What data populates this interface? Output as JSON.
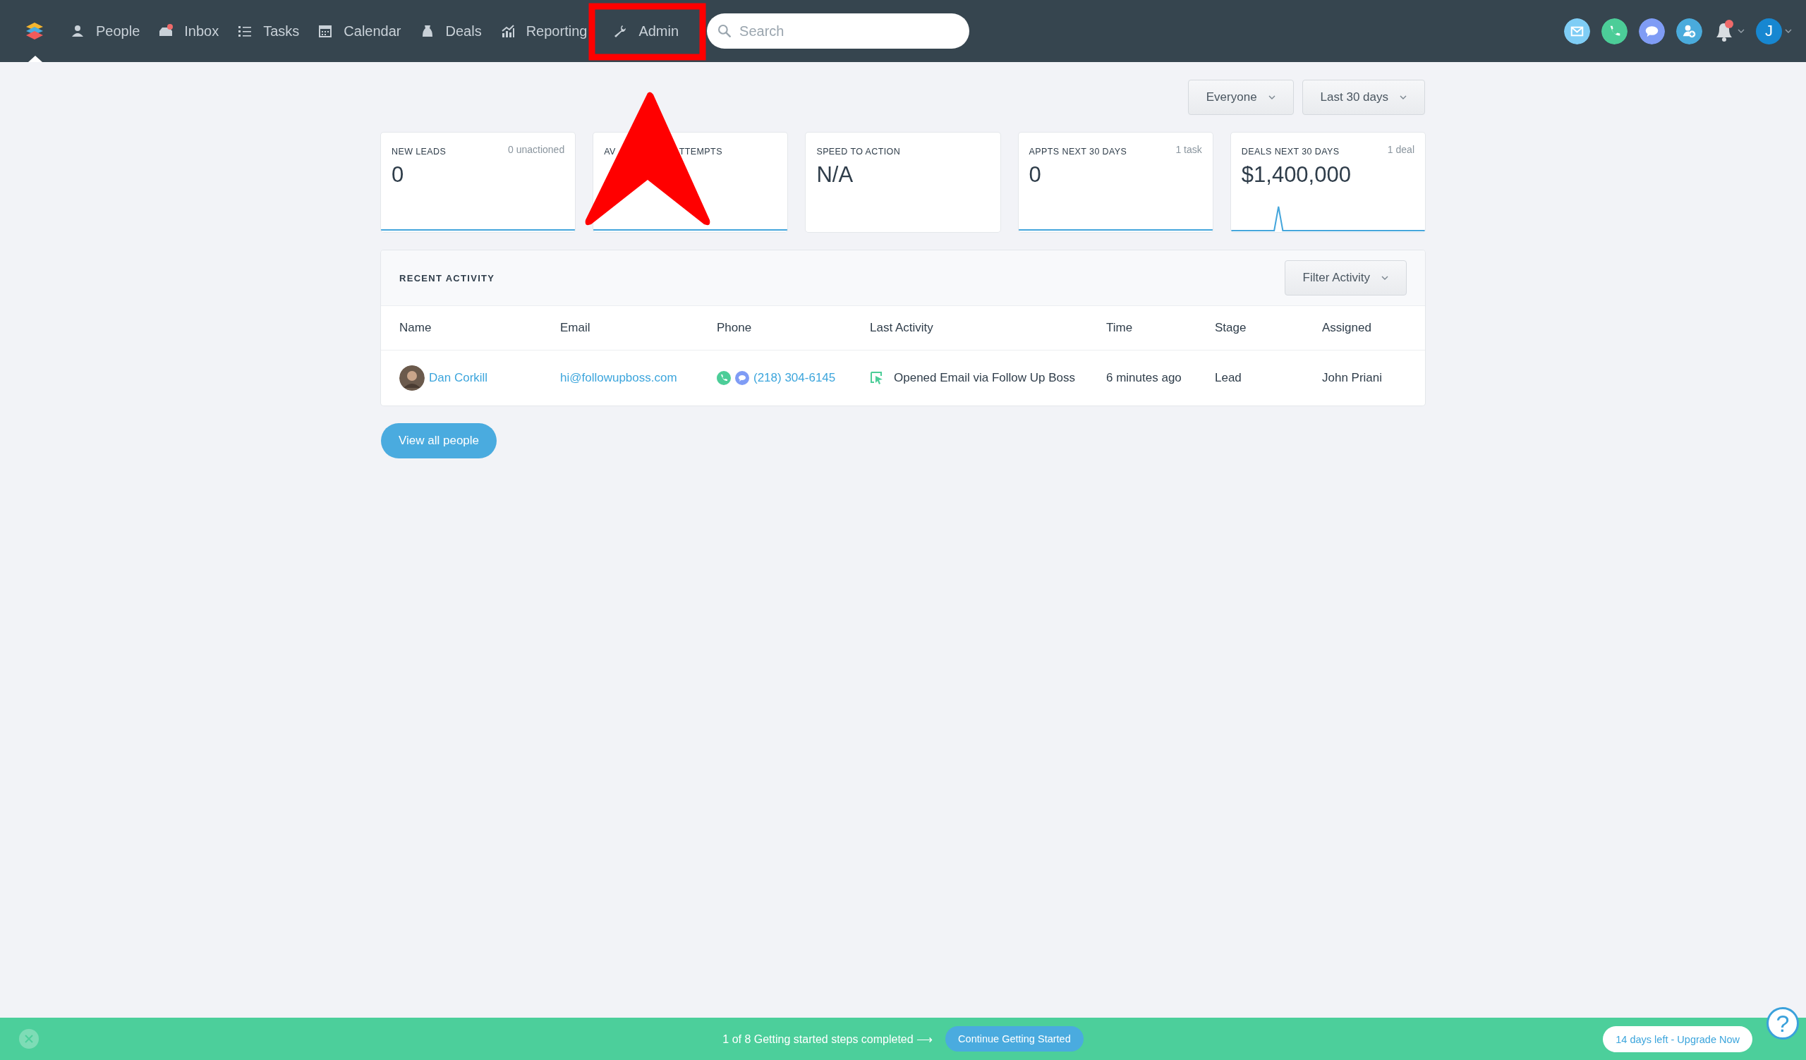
{
  "nav": {
    "home_selected": true,
    "items": [
      {
        "label": "People",
        "unread": false
      },
      {
        "label": "Inbox",
        "unread": true
      },
      {
        "label": "Tasks",
        "unread": false
      },
      {
        "label": "Calendar",
        "unread": false
      },
      {
        "label": "Deals",
        "unread": false
      },
      {
        "label": "Reporting",
        "unread": false
      },
      {
        "label": "Admin",
        "unread": false
      }
    ],
    "search": {
      "placeholder": "Search"
    },
    "actions": [
      {
        "kind": "email"
      },
      {
        "kind": "call"
      },
      {
        "kind": "text"
      },
      {
        "kind": "add-person"
      }
    ],
    "notifications": {
      "unread": true
    },
    "avatar": {
      "initial": "J"
    }
  },
  "filters": [
    "Everyone",
    "Last 30 days"
  ],
  "stats": [
    {
      "title": "NEW LEADS",
      "note": "0 unactioned",
      "value": "0",
      "kind": "flat"
    },
    {
      "title_start": "AV",
      "title_end": "TTEMPTS",
      "kind": "flat"
    },
    {
      "title": "SPEED TO ACTION",
      "value": "N/A",
      "kind": "blank"
    },
    {
      "title": "APPTS NEXT 30 DAYS",
      "note": "1 task",
      "value": "0",
      "kind": "flat"
    },
    {
      "title": "DEALS NEXT 30 DAYS",
      "note": "1 deal",
      "value": "$1,400,000",
      "kind": "peak"
    }
  ],
  "recent_activity": {
    "title": "RECENT ACTIVITY",
    "filter": "Filter Activity",
    "columns": [
      "Name",
      "Email",
      "Phone",
      "Last Activity",
      "Time",
      "Stage",
      "Assigned"
    ],
    "rows": [
      {
        "name": "Dan Corkill",
        "email": "hi@followupboss.com",
        "phone": "(218) 304-6145",
        "last_activity": "Opened Email via Follow Up Boss",
        "time": "6 minutes ago",
        "stage": "Lead",
        "assigned": "John Priani"
      }
    ]
  },
  "view_all": "View all people",
  "onboarding": {
    "progress": "1 of 8 Getting started steps completed ⟶",
    "button": "Continue Getting Started",
    "trial": "14 days left - Upgrade Now",
    "help": "?"
  }
}
